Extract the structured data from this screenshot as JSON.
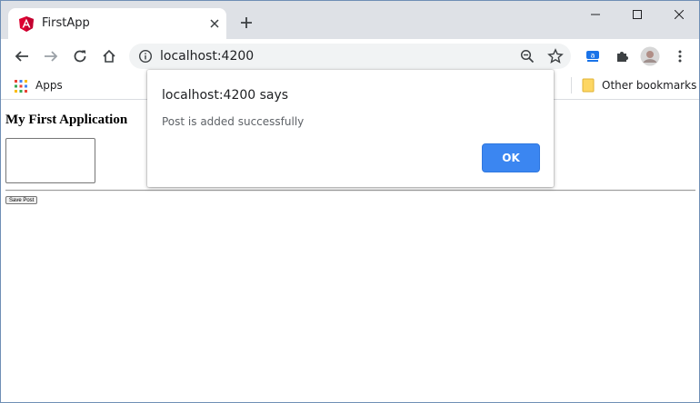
{
  "browser": {
    "tab": {
      "title": "FirstApp",
      "favicon": "angular-icon",
      "close_icon": "close-icon"
    },
    "new_tab_icon": "plus-icon",
    "window_controls": [
      "minimize-icon",
      "maximize-icon",
      "close-icon"
    ],
    "toolbar": {
      "back_icon": "arrow-left-icon",
      "forward_icon": "arrow-right-icon",
      "reload_icon": "reload-icon",
      "home_icon": "home-icon",
      "url": "localhost:4200",
      "info_icon": "info-icon",
      "zoom_icon": "zoom-out-icon",
      "star_icon": "star-icon",
      "extensions": [
        "translate-extension-icon",
        "puzzle-icon",
        "avatar",
        "more-vert-icon"
      ]
    },
    "bookmarks": {
      "apps_label": "Apps",
      "other_label": "Other bookmarks"
    }
  },
  "page": {
    "title": "My First Application",
    "textarea_value": "",
    "save_button_label": "Save Post"
  },
  "dialog": {
    "title": "localhost:4200 says",
    "message": "Post is added successfully",
    "ok_label": "OK"
  },
  "colors": {
    "accent": "#3b86f1",
    "tabstrip": "#dee1e6",
    "omnibox": "#f1f3f4"
  }
}
